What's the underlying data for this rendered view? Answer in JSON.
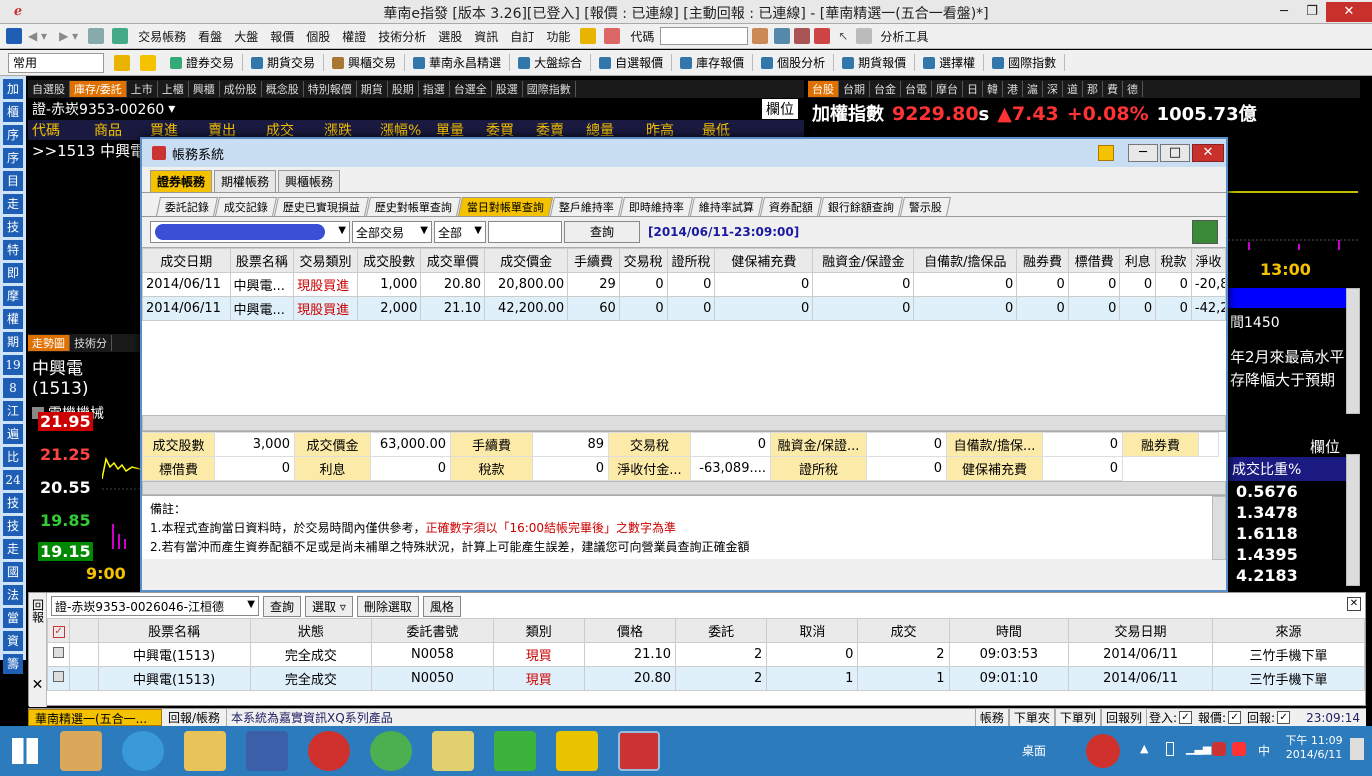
{
  "app_title": "華南e指發 [版本 3.26][已登入] [報價 : 已連線] [主動回報 : 已連線] - [華南精選一(五合一看盤)*]",
  "menu": [
    "交易帳務",
    "看盤",
    "大盤",
    "報價",
    "個股",
    "權證",
    "技術分析",
    "選股",
    "資訊",
    "自訂",
    "功能"
  ],
  "menu_code_label": "代碼",
  "menu_analysis": "分析工具",
  "toolbar2": {
    "combo": "常用",
    "items": [
      "證券交易",
      "期貨交易",
      "興櫃交易",
      "華南永昌精選",
      "大盤綜合",
      "自選報價",
      "庫存報價",
      "個股分析",
      "期貨報價",
      "選擇權",
      "國際指數"
    ]
  },
  "left_icons": [
    "加",
    "櫃",
    "序",
    "序",
    "目",
    "走",
    "技",
    "特",
    "即",
    "摩",
    "權",
    "期",
    "19",
    "8",
    "江",
    "遍",
    "比",
    "24",
    "技",
    "技",
    "走",
    "國",
    "法",
    "當",
    "資",
    "籌"
  ],
  "top_left_tabs": [
    "自選股",
    "庫存/委託",
    "上市",
    "上櫃",
    "興櫃",
    "成份股",
    "概念股",
    "特別報價",
    "期貨",
    "股期",
    "指選",
    "台選全",
    "股選",
    "國際指數"
  ],
  "top_left_account": "證-赤崁9353-00260",
  "top_left_col_label": "欄位",
  "top_left_headers": [
    "代碼",
    "商品",
    "買進",
    "賣出",
    "成交",
    "漲跌",
    "漲幅%",
    "單量",
    "委買",
    "委賣",
    "總量",
    "昨高",
    "最低"
  ],
  "top_left_row": ">>1513  中興電",
  "chart_left": {
    "tabs": [
      "走勢圖",
      "技術分"
    ],
    "name": "中興電(1513)",
    "sub": "電機機械",
    "prices": [
      "21.95",
      "21.25",
      "20.55",
      "19.85",
      "19.15"
    ],
    "time": "9:00"
  },
  "right_top": {
    "tabs": [
      "台股",
      "台期",
      "台金",
      "台電",
      "摩台",
      "日",
      "韓",
      "港",
      "滬",
      "深",
      "道",
      "那",
      "費",
      "德"
    ],
    "title": "加權指數",
    "price": "9229.80",
    "flag": "s",
    "change": "▲7.43",
    "pct": "+0.08%",
    "amount": "1005.73億",
    "time": "13:00"
  },
  "right_mid": {
    "line1": "間1450",
    "line2": "年2月來最高水平",
    "line3": "存降幅大于預期"
  },
  "right_bottom": {
    "col_label": "欄位",
    "header": "成交比重%",
    "values": [
      "0.5676",
      "1.3478",
      "1.6118",
      "1.4395",
      "4.2183"
    ]
  },
  "dialog": {
    "title": "帳務系統",
    "tabs": [
      "證券帳務",
      "期權帳務",
      "興櫃帳務"
    ],
    "subtabs": [
      "委託記錄",
      "成交記錄",
      "歷史已實現損益",
      "歷史對帳單查詢",
      "當日對帳單查詢",
      "整戶維持率",
      "即時維持率",
      "維持率試算",
      "資券配額",
      "銀行餘額查詢",
      "警示股"
    ],
    "filter1": "全部交易",
    "filter2": "全部",
    "query_btn": "查詢",
    "timestamp": "[2014/06/11-23:09:00]",
    "headers": [
      "成交日期",
      "股票名稱",
      "交易類別",
      "成交股數",
      "成交單價",
      "成交價金",
      "手續費",
      "交易稅",
      "證所稅",
      "健保補充費",
      "融資金/保證金",
      "自備款/擔保品",
      "融券費",
      "標借費",
      "利息",
      "稅款",
      "淨收"
    ],
    "rows": [
      [
        "2014/06/11",
        "中興電...",
        "現股買進",
        "1,000",
        "20.80",
        "20,800.00",
        "29",
        "0",
        "0",
        "0",
        "0",
        "0",
        "0",
        "0",
        "0",
        "0",
        "-20,8"
      ],
      [
        "2014/06/11",
        "中興電...",
        "現股買進",
        "2,000",
        "21.10",
        "42,200.00",
        "60",
        "0",
        "0",
        "0",
        "0",
        "0",
        "0",
        "0",
        "0",
        "0",
        "-42,2"
      ]
    ],
    "summary": [
      [
        [
          "成交股數",
          "3,000"
        ],
        [
          "成交價金",
          "63,000.00"
        ],
        [
          "手續費",
          "89"
        ],
        [
          "交易稅",
          "0"
        ],
        [
          "融資金/保證...",
          "0"
        ],
        [
          "自備款/擔保...",
          "0"
        ],
        [
          "融券費",
          ""
        ]
      ],
      [
        [
          "標借費",
          "0"
        ],
        [
          "利息",
          "0"
        ],
        [
          "稅款",
          "0"
        ],
        [
          "淨收付金...",
          "-63,089...."
        ],
        [
          "證所稅",
          "0"
        ],
        [
          "健保補充費",
          "0"
        ]
      ]
    ],
    "notes_title": "備註：",
    "note1a": "1.本程式查詢當日資料時，於交易時間內僅供參考，",
    "note1b": "正確數字須以「16:00結帳完畢後」之數字為準",
    "note2": "2.若有當沖而產生資券配額不足或是尚未補單之特殊狀況，計算上可能產生誤差，建議您可向營業員查詢正確金額"
  },
  "order_panel": {
    "side_label": "回報",
    "account": "證-赤崁9353-0026046-江桓德",
    "buttons": [
      "查詢",
      "選取",
      "刪除選取",
      "風格"
    ],
    "headers": [
      "股票名稱",
      "狀態",
      "委託書號",
      "類別",
      "價格",
      "委託",
      "取消",
      "成交",
      "時間",
      "交易日期",
      "來源"
    ],
    "rows": [
      [
        "中興電(1513)",
        "完全成交",
        "N0058",
        "現買",
        "21.10",
        "2",
        "0",
        "2",
        "09:03:53",
        "2014/06/11",
        "三竹手機下單"
      ],
      [
        "中興電(1513)",
        "完全成交",
        "N0050",
        "現買",
        "20.80",
        "2",
        "1",
        "1",
        "09:01:10",
        "2014/06/11",
        "三竹手機下單"
      ]
    ]
  },
  "statusbar": {
    "tab1": "華南精選一(五合一...",
    "tab2": "回報/帳務",
    "msg": "本系統為嘉實資訊XQ系列產品",
    "btns": [
      "帳務",
      "下單夾",
      "下單列",
      "回報列"
    ],
    "login": "登入:",
    "report": "報價:",
    "reply": "回報:",
    "time": "23:09:14"
  },
  "taskbar": {
    "desk": "桌面",
    "ime": "中",
    "time": "下午 11:09",
    "date": "2014/6/11"
  },
  "colors": {
    "accent": "#f5c200",
    "red": "#cc0000",
    "blue": "#1e5fb5",
    "dark": "#000000"
  }
}
